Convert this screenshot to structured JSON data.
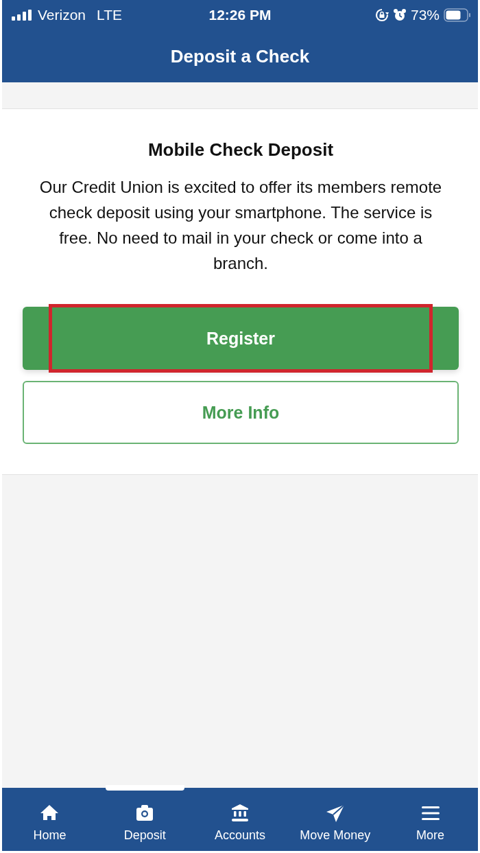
{
  "status_bar": {
    "carrier": "Verizon",
    "network": "LTE",
    "time": "12:26 PM",
    "battery": "73%"
  },
  "header": {
    "title": "Deposit a Check"
  },
  "card": {
    "title": "Mobile Check Deposit",
    "body": "Our Credit Union is excited to offer its members remote check deposit using your smartphone. The service is free. No need to mail in your check or come into a branch.",
    "buttons": [
      {
        "label": "Register",
        "kind": "primary",
        "highlighted": true
      },
      {
        "label": "More Info",
        "kind": "outline",
        "highlighted": false
      }
    ]
  },
  "tab_bar": [
    {
      "label": "Home",
      "kind": "home",
      "selected": false
    },
    {
      "label": "Deposit",
      "kind": "deposit",
      "selected": true
    },
    {
      "label": "Accounts",
      "kind": "accounts",
      "selected": false
    },
    {
      "label": "Move Money",
      "kind": "transfer",
      "selected": false
    },
    {
      "label": "More",
      "kind": "more",
      "selected": false
    }
  ]
}
